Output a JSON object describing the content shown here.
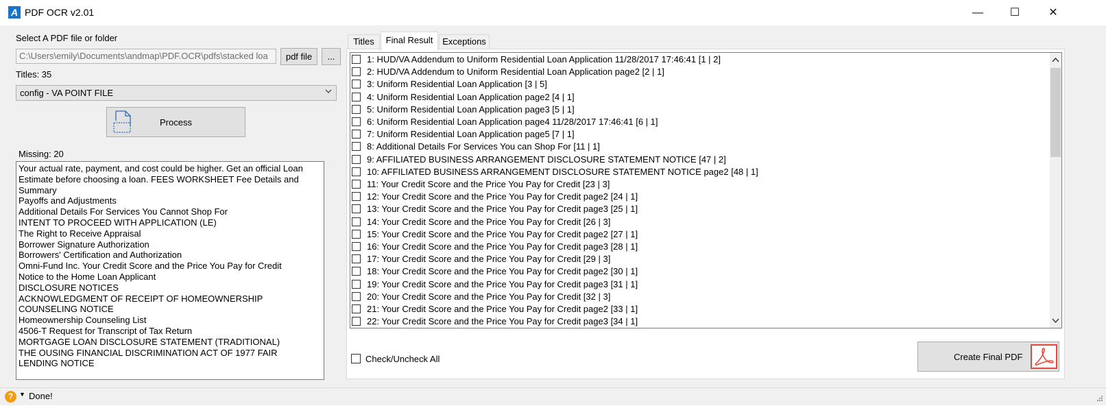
{
  "window": {
    "title": "PDF OCR v2.01",
    "app_icon": "A",
    "minimize": "—",
    "maximize": "☐",
    "close": "✕"
  },
  "left": {
    "select_label": "Select A PDF file or folder",
    "path_value": "C:\\Users\\emily\\Documents\\andmap\\PDF.OCR\\pdfs\\stacked loa",
    "pdf_file_button": "pdf file",
    "browse_button": "...",
    "titles_label": "Titles: 35",
    "config_selected": "config - VA POINT FILE",
    "process_button": "Process",
    "missing_label": "Missing: 20",
    "missing_lines": [
      "Your actual rate, payment, and cost could be higher. Get an official Loan",
      "Estimate before choosing a loan.  FEES WORKSHEET    Fee Details and",
      "Summary",
      "Payoffs and Adjustments",
      "Additional Details For Services You Cannot Shop For",
      "INTENT TO PROCEED WITH APPLICATION (LE)",
      "The Right to Receive Appraisal",
      "Borrower Signature Authorization",
      "Borrowers' Certification and Authorization",
      "Omni-Fund Inc.  Your Credit Score and the Price You Pay for Credit",
      "Notice to the Home Loan Applicant",
      "DISCLOSURE NOTICES",
      "ACKNOWLEDGMENT OF RECEIPT OF HOMEOWNERSHIP",
      "COUNSELING NOTICE",
      "Homeownership Counseling List",
      "4506-T Request for Transcript of Tax Return",
      "MORTGAGE LOAN DISCLOSURE STATEMENT (TRADITIONAL)",
      "THE OUSING FINANCIAL DISCRIMINATION ACT OF 1977  FAIR",
      "LENDING NOTICE"
    ]
  },
  "tabs": [
    {
      "label": "Titles"
    },
    {
      "label": "Final Result"
    },
    {
      "label": "Exceptions"
    }
  ],
  "final_result_items": [
    "1: HUD/VA Addendum to Uniform Residential Loan Application 11/28/2017 17:46:41 [1 | 2]",
    "2: HUD/VA Addendum to Uniform Residential Loan Application page2  [2 | 1]",
    "3: Uniform Residential Loan Application  [3 | 5]",
    "4: Uniform Residential Loan Application page2  [4 | 1]",
    "5: Uniform Residential Loan Application page3  [5 | 1]",
    "6: Uniform Residential Loan Application page4 11/28/2017 17:46:41 [6 | 1]",
    "7: Uniform Residential Loan Application page5  [7 | 1]",
    "8: Additional Details For Services You can Shop For  [11 | 1]",
    "9: AFFILIATED BUSINESS ARRANGEMENT DISCLOSURE STATEMENT NOTICE  [47 | 2]",
    "10: AFFILIATED BUSINESS ARRANGEMENT DISCLOSURE STATEMENT NOTICE page2  [48 | 1]",
    "11: Your Credit Score and the Price You Pay for Credit  [23 | 3]",
    "12: Your Credit Score and the Price You Pay for Credit page2  [24 | 1]",
    "13: Your Credit Score and the Price You Pay for Credit page3  [25 | 1]",
    "14: Your Credit Score and the Price You Pay for Credit  [26 | 3]",
    "15: Your Credit Score and the Price You Pay for Credit page2  [27 | 1]",
    "16: Your Credit Score and the Price You Pay for Credit page3  [28 | 1]",
    "17: Your Credit Score and the Price You Pay for Credit  [29 | 3]",
    "18: Your Credit Score and the Price You Pay for Credit page2  [30 | 1]",
    "19: Your Credit Score and the Price You Pay for Credit page3  [31 | 1]",
    "20: Your Credit Score and the Price You Pay for Credit  [32 | 3]",
    "21: Your Credit Score and the Price You Pay for Credit page2  [33 | 1]",
    "22: Your Credit Score and the Price You Pay for Credit page3  [34 | 1]"
  ],
  "check_all_label": "Check/Uncheck All",
  "create_button": "Create Final PDF",
  "status": {
    "help_glyph": "?",
    "text": "Done!"
  },
  "colors": {
    "accent": "#1a73c9",
    "pdf_red": "#e24a3b",
    "help_orange": "#f39c12"
  }
}
